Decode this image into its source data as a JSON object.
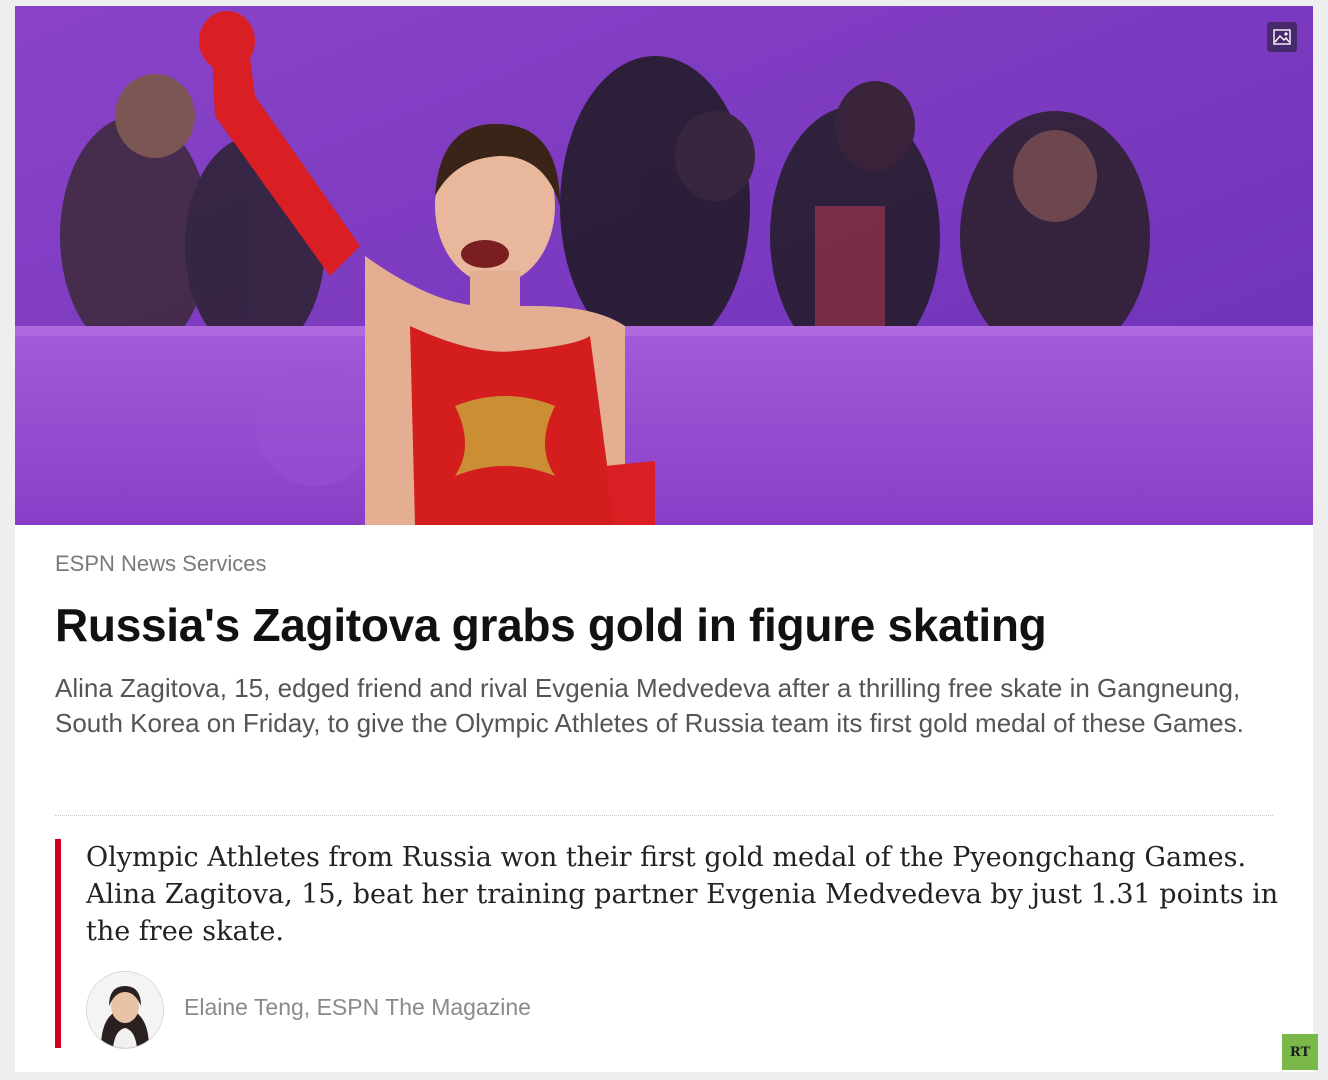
{
  "article": {
    "source": "ESPN News Services",
    "headline": "Russia's Zagitova grabs gold in figure skating",
    "summary": "Alina Zagitova, 15, edged friend and rival Evgenia Medvedeva after a thrilling free skate in Gangneung, South Korea on Friday, to give the Olympic Athletes of Russia team its first gold medal of these Games."
  },
  "quote": {
    "text": "Olympic Athletes from Russia won their first gold medal of the Pyeongchang Games. Alina Zagitova, 15, beat her training partner Evgenia Medvedeva by just 1.31 points in the free skate.",
    "byline": "Elaine Teng, ESPN The Magazine"
  },
  "badge": {
    "label": "RT"
  },
  "icons": {
    "media": "image-icon",
    "avatar": "author-avatar"
  },
  "colors": {
    "accent": "#d0021b",
    "headline": "#111111",
    "summary": "#555555",
    "source": "#7a7a7a",
    "hero_background": "#7a3fc0",
    "costume": "#d41e1e",
    "badge": "#7bb84a"
  }
}
